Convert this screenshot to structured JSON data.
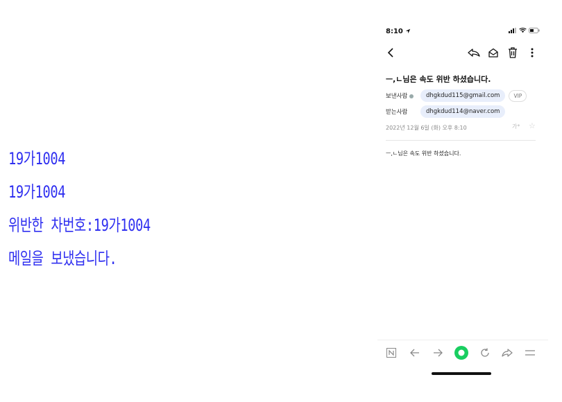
{
  "console": {
    "lines": [
      "19가1004",
      "19가1004",
      "위반한 차번호:19가1004",
      "메일을 보냈습니다."
    ]
  },
  "phone": {
    "status_time": "8:10",
    "subject": "ㅡ,ㄴ님은 속도 위반 하셨습니다.",
    "sender_label": "보낸사람",
    "sender_email": "dhgkdud115@gmail.com",
    "vip_label": "VIP",
    "recipient_label": "받는사람",
    "recipient_email": "dhgkdud114@naver.com",
    "date": "2022년 12월 6일 (화) 오후 8:10",
    "font_size_label": "가*",
    "body": "ㅡ,ㄴ님은 속도 위반 하셨습니다."
  },
  "icons": {
    "toolbar": [
      "back-icon",
      "reply-icon",
      "mark-unread-icon",
      "trash-icon",
      "more-icon"
    ],
    "bottom": [
      "naver-logo-icon",
      "nav-back-icon",
      "nav-forward-icon",
      "green-dot-icon",
      "refresh-icon",
      "share-icon",
      "menu-icon"
    ]
  },
  "colors": {
    "console_text": "#2f2ff0",
    "chip_bg": "#e8eefb",
    "green": "#19ce60"
  }
}
